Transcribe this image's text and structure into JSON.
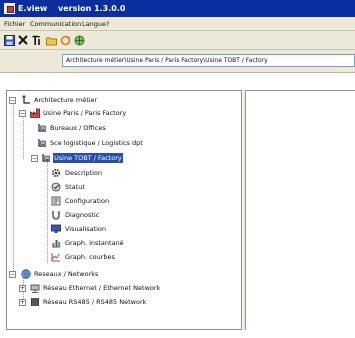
{
  "window": {
    "app_name": "E.view",
    "version": "version 1.3.0.0"
  },
  "menu": [
    "Fichier",
    "Communication",
    "Langue",
    "?"
  ],
  "path": "Architecture métier\\Usine Paris / Paris Factory\\Usine TOBT / Factory",
  "tree": {
    "architecture": "Architecture métier",
    "usine_paris": "Usine Paris / Paris Factory",
    "bureaux": "Bureaux / Offices",
    "logistique": "Sce logistique / Logistics dpt",
    "usine_tobt": "Usine TOBT / Factory",
    "description": "Description",
    "statut": "Statut",
    "configuration": "Configuration",
    "diagnostic": "Diagnostic",
    "visualisation": "Visualisation",
    "graph_instantane": "Graph. instantané",
    "graph_courbes": "Graph. courbes",
    "reseaux": "Reseaux / Networks",
    "ethernet": "Réseau Ethernet / Ethernet Network",
    "rs485": "Réseau RS485 / RS485 Network"
  },
  "colors": {
    "title_bar": "#0a2ea0",
    "selection": "#2a4fa8",
    "chrome": "#ece9d8"
  }
}
